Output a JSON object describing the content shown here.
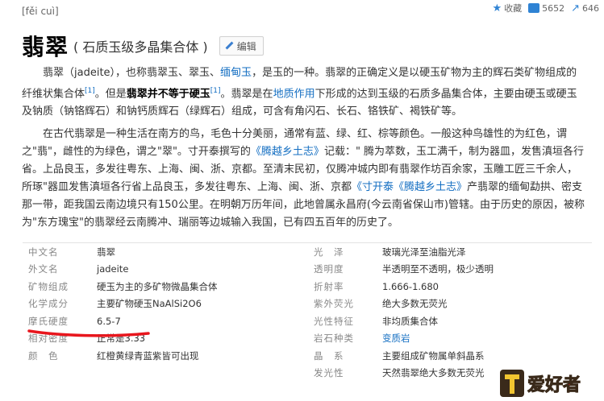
{
  "header": {
    "pinyin": "[fěi cuì]",
    "title": "翡翠",
    "subtitle": "( 石质玉级多晶集合体 )",
    "edit_label": "编辑",
    "collect_label": "收藏",
    "like_count": "5652",
    "share_count": "646"
  },
  "intro": {
    "p1_a": "翡翠（jadeite），也称翡翠玉、翠玉、",
    "p1_link": "缅甸玉",
    "p1_b": "，是玉的一种。翡翠的正确定义是以硬玉矿物为主的辉石类矿物组成的纤维状集合体",
    "ref1": "[1]",
    "p1_c": "。但是",
    "p1_bold": "翡翠并不等于硬玉",
    "ref2": "[1]",
    "p1_d": "。翡翠是在",
    "p1_link2": "地质作用",
    "p1_e": "下形成的达到玉级的石质多晶集合体，主要由硬玉或硬玉及钠质（钠铬辉石）和钠钙质辉石（绿辉石）组成，可含有角闪石、长石、铬铁矿、褐铁矿等。"
  },
  "history": {
    "a": "在古代翡翠是一种生活在南方的鸟，毛色十分美丽，通常有蓝、绿、红、棕等颜色。一般这种鸟雄性的为红色，谓之\"翡\"，雌性的为绿色，谓之\"翠\"。寸开泰撰写的",
    "link1": "《腾越乡土志》",
    "b": "记载：\" 腾为萃数，玉工满千，制为器皿，发售滇垣各行省。上品良玉，多发往粤东、上海、闽、浙、京都。至清末民初，仅腾冲城内即有翡翠作坊百余家，玉雕工匠三千余人，所琢\"器皿发售滇垣各行省上品良玉，多发往粤东、上海、闽、浙、京都",
    "link2": "《寸开泰《腾越乡土志》",
    "c": "产翡翠的缅甸勐拱、密支那一带，距我国云南边境只有150公里。在明朝万历年间，此地曾属永昌府(今云南省保山市)管辖。由于历史的原因，被称为\"东方瑰宝\"的翡翠经云南腾冲、瑞丽等边城输入我国，已有四五百年的历史了。"
  },
  "infobox": {
    "left": [
      {
        "label": "中文名",
        "value": "翡翠"
      },
      {
        "label": "外文名",
        "value": "jadeite"
      },
      {
        "label": "矿物组成",
        "value": "硬玉为主的多矿物微晶集合体"
      },
      {
        "label": "化学成分",
        "value": "主要矿物硬玉NaAlSi2O6"
      },
      {
        "label": "摩氏硬度",
        "value": "6.5-7"
      },
      {
        "label": "相对密度",
        "value": "正常是3.33"
      },
      {
        "label": "颜　色",
        "value": "红橙黄绿青蓝紫皆可出现"
      }
    ],
    "right": [
      {
        "label": "光　泽",
        "value": "玻璃光泽至油脂光泽"
      },
      {
        "label": "透明度",
        "value": "半透明至不透明，极少透明"
      },
      {
        "label": "折射率",
        "value": "1.666-1.680"
      },
      {
        "label": "紫外荧光",
        "value": "绝大多数无荧光"
      },
      {
        "label": "光性特征",
        "value": "非均质集合体"
      },
      {
        "label": "岩石种类",
        "value": "变质岩"
      },
      {
        "label": "晶　系",
        "value": "主要组成矿物属单斜晶系"
      },
      {
        "label": "发光性",
        "value": "天然翡翠绝大多数无荧光"
      }
    ]
  },
  "watermark": {
    "text": "爱好者"
  }
}
